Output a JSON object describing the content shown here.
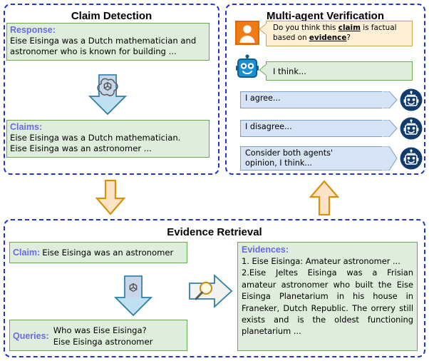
{
  "panels": {
    "claim_detection": {
      "title": "Claim Detection",
      "response_label": "Response:",
      "response_text": "Eise Eisinga was a Dutch mathematician and\nastronomer who is known for building ...",
      "claims_label": "Claims:",
      "claims_text": "Eise Eisinga was a Dutch mathematician.\nEise Eisinga was an astronomer ..."
    },
    "multi_agent_verification": {
      "title": "Multi-agent Verification",
      "question_prefix": "Do you think this ",
      "question_kw1": "claim",
      "question_mid": " is factual based on ",
      "question_kw2": "evidence",
      "question_suffix": "?",
      "think_text": "I think...",
      "agents": [
        {
          "text": "I agree..."
        },
        {
          "text": "I disagree..."
        },
        {
          "text": "Consider both agents'\nopinion, I think..."
        }
      ]
    },
    "evidence_retrieval": {
      "title": "Evidence Retrieval",
      "claim_label": "Claim:",
      "claim_text": "Eise Eisinga was an astronomer",
      "queries_label": "Queries:",
      "queries_text": "Who was Eise Eisinga?\nEise Eisinga astronomer",
      "evidences_label": "Evidences:",
      "evidence_1": "1. Eise Eisinga: Amateur astronomer ...",
      "evidence_2": "2.Eise Jeltes Eisinga was a Frisian amateur astronomer who built the Eise Eisinga Planetarium in his house in Franeker, Dutch Republic. The orrery still exists and is the oldest functioning planetarium ..."
    }
  },
  "icons": {
    "user_avatar": "user-avatar-icon",
    "bot_avatar": "robot-avatar-icon",
    "agent_icon": "robot-circle-icon",
    "llm_icon": "openai-logo-icon",
    "search_icon": "magnifier-icon",
    "flow_down": "arrow-down-icon",
    "flow_up": "arrow-up-icon"
  },
  "colors": {
    "panel_border": "#2233cc",
    "green_fill": "#dfeedc",
    "green_border": "#6aa84f",
    "label_purple": "#6a6ae0",
    "orange_arrow_fill": "#fce3c8",
    "orange_arrow_border": "#d8920a",
    "blue_arrow_fill": "#bfe0f0",
    "blue_arrow_border": "#2f7fa8",
    "bubble_blue_fill": "#d6e3f5",
    "bubble_blue_border": "#7b9ec9",
    "bubble_cream_fill": "#fdf0d5",
    "bubble_cream_border": "#c8a64a",
    "user_orange": "#ef7b17",
    "robot_blue": "#1a8fd1",
    "robot_navy": "#123a6b"
  }
}
